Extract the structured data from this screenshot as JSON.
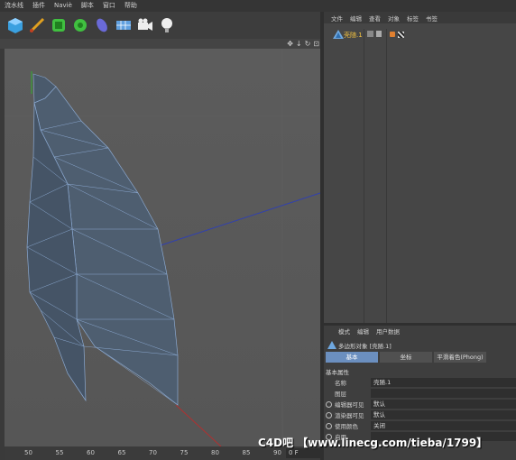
{
  "menu": [
    "流水线",
    "插件",
    "Naviè",
    "脚本",
    "窗口",
    "帮助"
  ],
  "toolbar": [
    {
      "name": "cube-icon",
      "color": "#3aa0e0"
    },
    {
      "name": "pen-icon",
      "color": "#e0a020"
    },
    {
      "name": "subdivision-icon",
      "color": "#40c040"
    },
    {
      "name": "array-icon",
      "color": "#40c040"
    },
    {
      "name": "deformer-icon",
      "color": "#6a6ad8"
    },
    {
      "name": "floor-icon",
      "color": "#60a0e0"
    },
    {
      "name": "camera-icon",
      "color": "#eeeeee"
    },
    {
      "name": "light-icon",
      "color": "#eeeeee"
    }
  ],
  "viewport_icons": [
    "✥",
    "↓",
    "↻",
    "⊡"
  ],
  "object_manager": {
    "menu": [
      "文件",
      "编辑",
      "查看",
      "对象",
      "标签",
      "书签"
    ],
    "object_name": "壳随.1"
  },
  "attributes": {
    "menu": [
      "模式",
      "编辑",
      "用户数据"
    ],
    "title": "多边形对象 [壳随.1]",
    "tabs": [
      "基本",
      "坐标",
      "平滑着色(Phong)"
    ],
    "active_tab": 0,
    "section": "基本属性",
    "rows": [
      {
        "label": "名称",
        "value": "壳随.1",
        "radio": false
      },
      {
        "label": "图层",
        "value": "",
        "radio": false
      },
      {
        "label": "编辑器可见",
        "value": "默认",
        "radio": true
      },
      {
        "label": "渲染器可见",
        "value": "默认",
        "radio": true
      },
      {
        "label": "使用颜色",
        "value": "关闭",
        "radio": true
      },
      {
        "label": "启用",
        "value": "",
        "radio": true
      }
    ]
  },
  "timeline": {
    "ticks": [
      "50",
      "55",
      "60",
      "65",
      "70",
      "75",
      "80",
      "85",
      "90"
    ],
    "frame": "0 F"
  },
  "watermark": "C4D吧 【www.linecg.com/tieba/1799】"
}
